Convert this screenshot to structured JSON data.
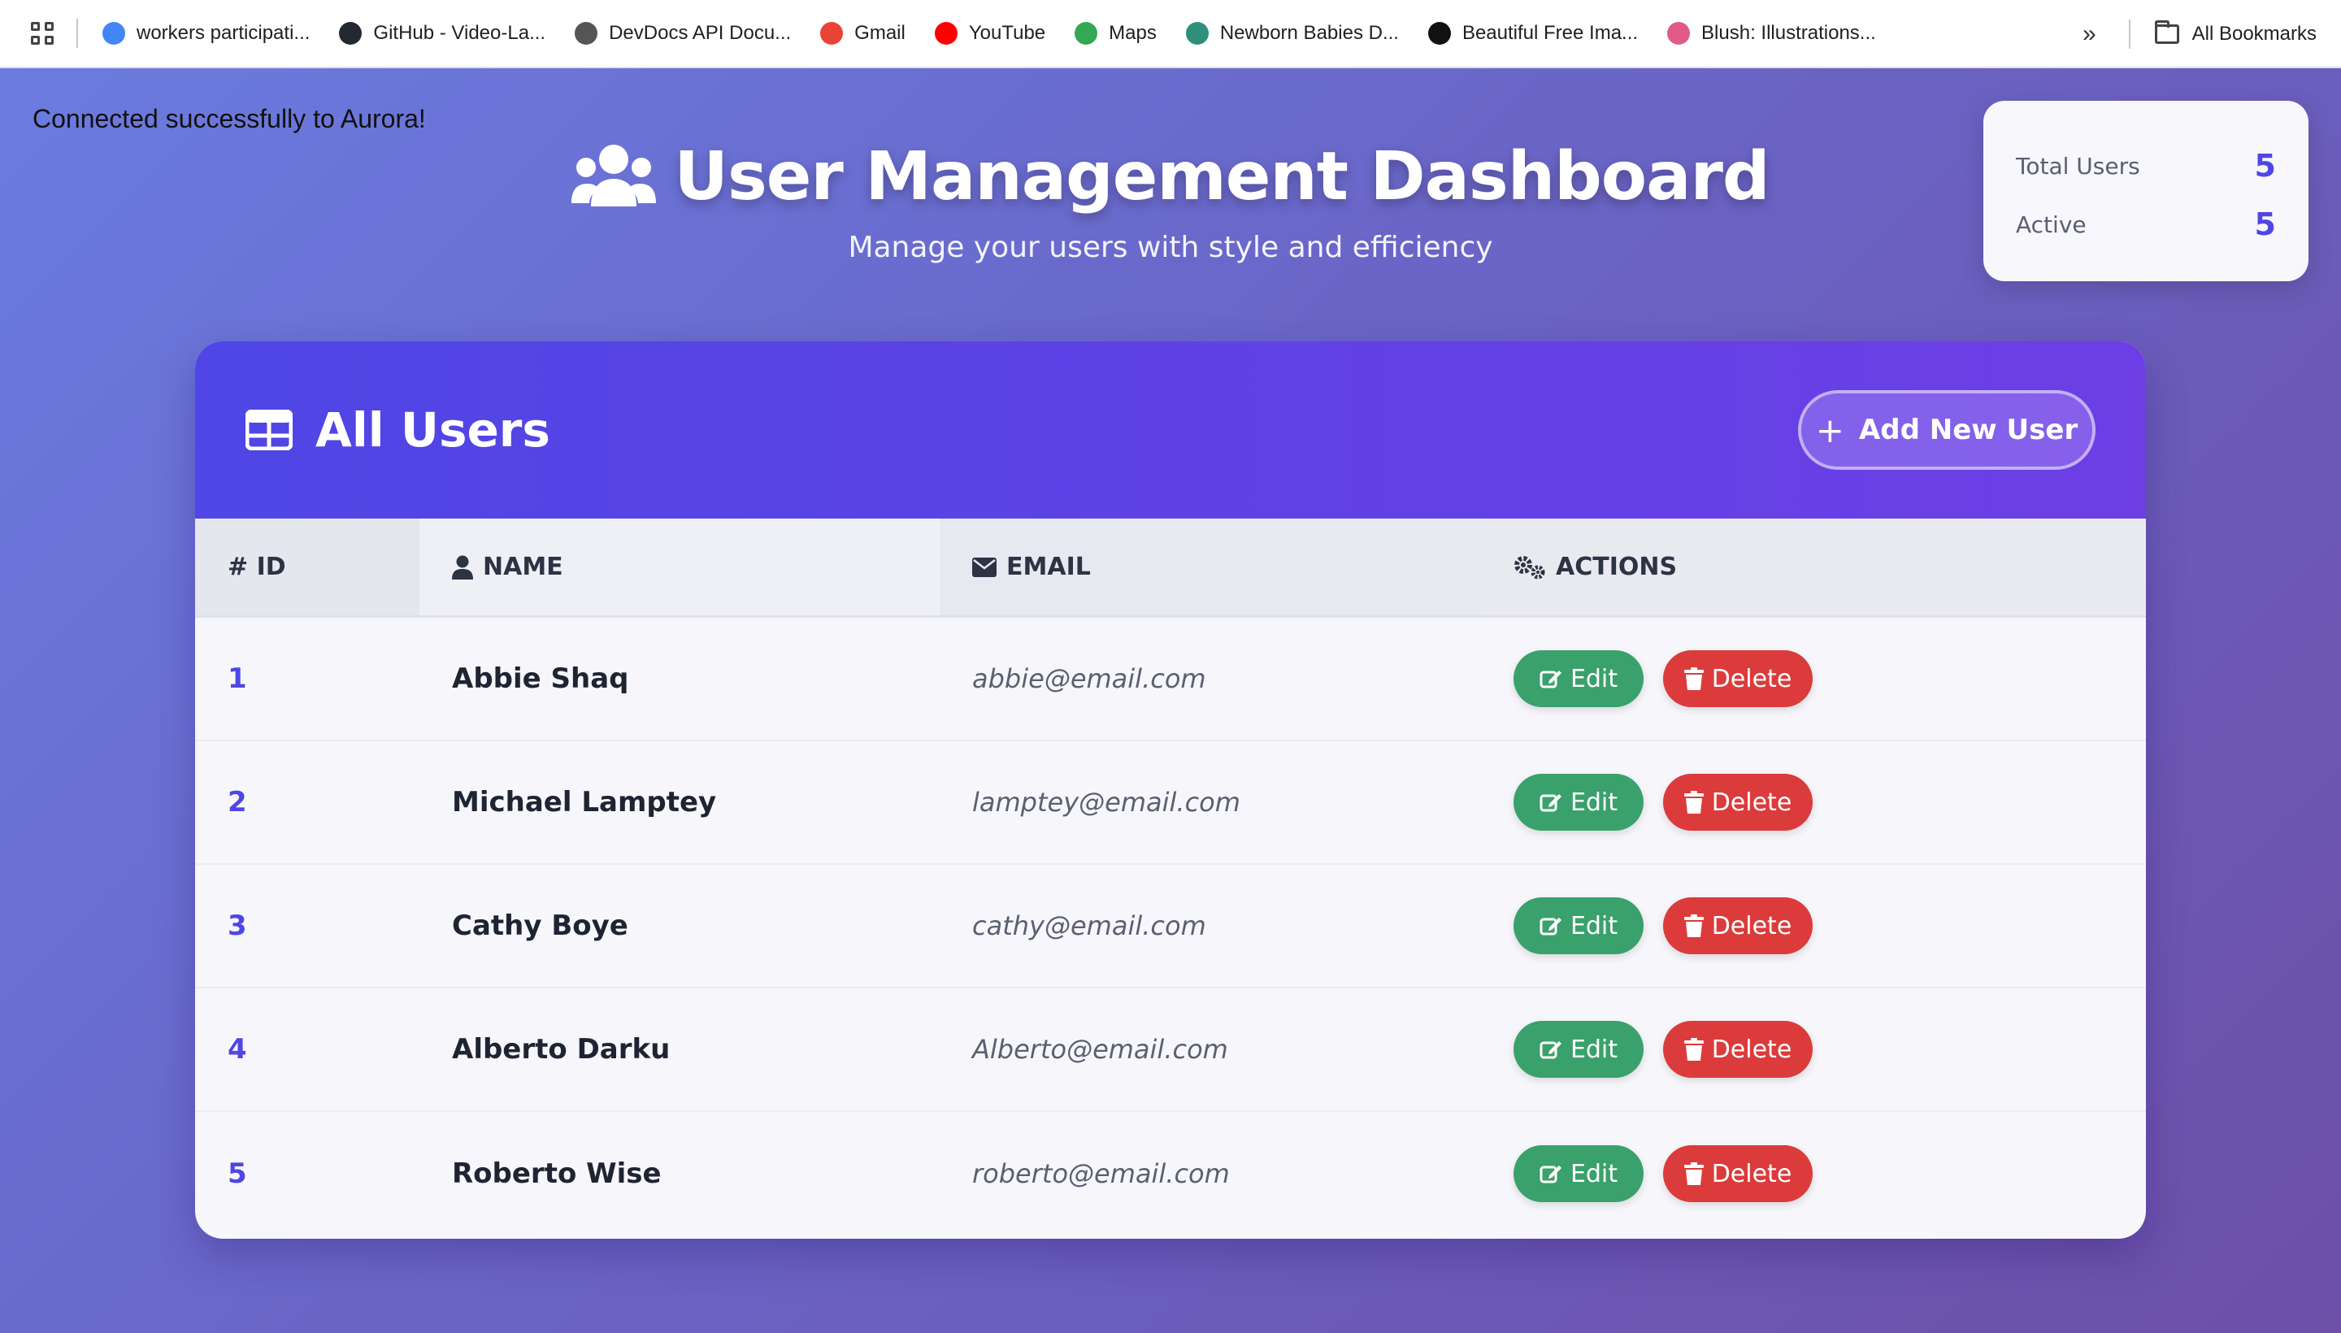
{
  "bookmarks": [
    {
      "label": "workers participati...",
      "icon": "google-icon",
      "color": "#4285f4"
    },
    {
      "label": "GitHub - Video-La...",
      "icon": "github-icon",
      "color": "#24292f"
    },
    {
      "label": "DevDocs API Docu...",
      "icon": "devdocs-icon",
      "color": "#555555"
    },
    {
      "label": "Gmail",
      "icon": "gmail-icon",
      "color": "#ea4335"
    },
    {
      "label": "YouTube",
      "icon": "youtube-icon",
      "color": "#ff0000"
    },
    {
      "label": "Maps",
      "icon": "maps-icon",
      "color": "#34a853"
    },
    {
      "label": "Newborn Babies D...",
      "icon": "newborn-icon",
      "color": "#2f8f7a"
    },
    {
      "label": "Beautiful Free Ima...",
      "icon": "unsplash-icon",
      "color": "#111111"
    },
    {
      "label": "Blush: Illustrations...",
      "icon": "blush-icon",
      "color": "#e05a8a"
    }
  ],
  "bookmarks_more": "»",
  "all_bookmarks": "All Bookmarks",
  "status": "Connected successfully to Aurora!",
  "header": {
    "title": "User Management Dashboard",
    "subtitle": "Manage your users with style and efficiency"
  },
  "stats": {
    "total_label": "Total Users",
    "total_value": "5",
    "active_label": "Active",
    "active_value": "5"
  },
  "panel": {
    "title": "All Users",
    "add_button": "Add New User",
    "add_button_icon": "+"
  },
  "table": {
    "headers": {
      "id": "# ID",
      "name": "NAME",
      "email": "EMAIL",
      "actions": "ACTIONS"
    },
    "rows": [
      {
        "id": "1",
        "name": "Abbie Shaq",
        "email": "abbie@email.com"
      },
      {
        "id": "2",
        "name": "Michael Lamptey",
        "email": "lamptey@email.com"
      },
      {
        "id": "3",
        "name": "Cathy Boye",
        "email": "cathy@email.com"
      },
      {
        "id": "4",
        "name": "Alberto Darku",
        "email": "Alberto@email.com"
      },
      {
        "id": "5",
        "name": "Roberto Wise",
        "email": "roberto@email.com"
      }
    ],
    "edit_label": "Edit",
    "delete_label": "Delete"
  },
  "colors": {
    "accent": "#4f46e5",
    "edit": "#3aa16c",
    "delete": "#dc3b3b"
  }
}
